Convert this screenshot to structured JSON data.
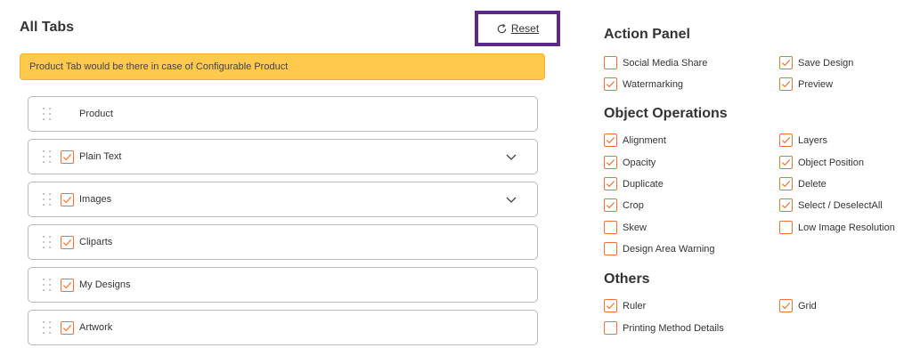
{
  "left": {
    "title": "All Tabs",
    "reset_label": "Reset",
    "notice": "Product Tab would be there in case of Configurable Product",
    "tabs": [
      {
        "label": "Product",
        "checkbox": false,
        "checked": false,
        "expandable": false
      },
      {
        "label": "Plain Text",
        "checkbox": true,
        "checked": true,
        "expandable": true
      },
      {
        "label": "Images",
        "checkbox": true,
        "checked": true,
        "expandable": true
      },
      {
        "label": "Cliparts",
        "checkbox": true,
        "checked": true,
        "expandable": false
      },
      {
        "label": "My Designs",
        "checkbox": true,
        "checked": true,
        "expandable": false
      },
      {
        "label": "Artwork",
        "checkbox": true,
        "checked": true,
        "expandable": false
      }
    ]
  },
  "right": {
    "action_panel": {
      "title": "Action Panel",
      "options": [
        {
          "label": "Social Media Share",
          "checked": false
        },
        {
          "label": "Save Design",
          "checked": true
        },
        {
          "label": "Watermarking",
          "checked": true
        },
        {
          "label": "Preview",
          "checked": true
        }
      ]
    },
    "object_operations": {
      "title": "Object Operations",
      "options": [
        {
          "label": "Alignment",
          "checked": true
        },
        {
          "label": "Layers",
          "checked": true
        },
        {
          "label": "Opacity",
          "checked": true
        },
        {
          "label": "Object Position",
          "checked": true
        },
        {
          "label": "Duplicate",
          "checked": true
        },
        {
          "label": "Delete",
          "checked": true
        },
        {
          "label": "Crop",
          "checked": true
        },
        {
          "label": "Select / DeselectAll",
          "checked": true
        },
        {
          "label": "Skew",
          "checked": false
        },
        {
          "label": "Low Image Resolution",
          "checked": false
        },
        {
          "label": "Design Area Warning",
          "checked": false
        }
      ]
    },
    "others": {
      "title": "Others",
      "options": [
        {
          "label": "Ruler",
          "checked": true
        },
        {
          "label": "Grid",
          "checked": true
        },
        {
          "label": "Printing Method Details",
          "checked": false
        }
      ]
    }
  },
  "colors": {
    "accent": "#e8743b",
    "notice_bg": "#ffc94d",
    "highlight_border": "#5b2a86"
  },
  "icons": {
    "reset": "refresh-icon",
    "drag": "drag-handle-icon",
    "expand": "chevron-down-icon",
    "check": "checkmark-icon"
  }
}
